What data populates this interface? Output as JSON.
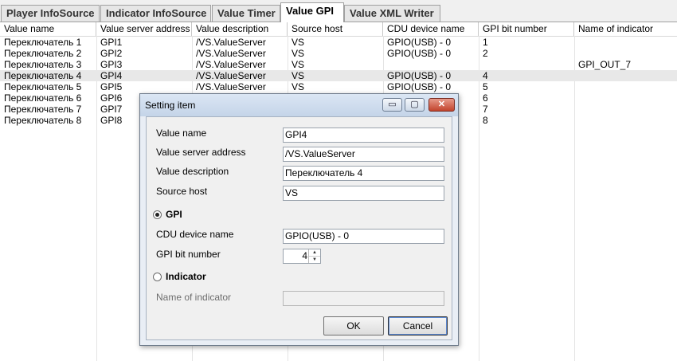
{
  "tabs": [
    {
      "label": "Player InfoSource",
      "active": false
    },
    {
      "label": "Indicator InfoSource",
      "active": false
    },
    {
      "label": "Value Timer",
      "active": false
    },
    {
      "label": "Value GPI",
      "active": true
    },
    {
      "label": "Value XML Writer",
      "active": false
    }
  ],
  "grid": {
    "columns": [
      "Value name",
      "Value server address",
      "Value description",
      "Source host",
      "CDU device name",
      "GPI bit number",
      "Name of indicator"
    ],
    "rows": [
      [
        "Переключатель 1",
        "GPI1",
        "/VS.ValueServer",
        "VS",
        "GPIO(USB) - 0",
        "1",
        ""
      ],
      [
        "Переключатель 2",
        "GPI2",
        "/VS.ValueServer",
        "VS",
        "GPIO(USB) - 0",
        "2",
        ""
      ],
      [
        "Переключатель 3",
        "GPI3",
        "/VS.ValueServer",
        "VS",
        "",
        "",
        "GPI_OUT_7"
      ],
      [
        "Переключатель 4",
        "GPI4",
        "/VS.ValueServer",
        "VS",
        "GPIO(USB) - 0",
        "4",
        ""
      ],
      [
        "Переключатель 5",
        "GPI5",
        "/VS.ValueServer",
        "VS",
        "GPIO(USB) - 0",
        "5",
        ""
      ],
      [
        "Переключатель 6",
        "GPI6",
        "",
        "",
        "",
        "6",
        ""
      ],
      [
        "Переключатель 7",
        "GPI7",
        "",
        "",
        "",
        "7",
        ""
      ],
      [
        "Переключатель 8",
        "GPI8",
        "",
        "",
        "",
        "8",
        ""
      ]
    ],
    "selected_row": 3
  },
  "dialog": {
    "title": "Setting item",
    "window_buttons": {
      "minimize": "▭",
      "maximize": "▢",
      "close": "✕"
    },
    "labels": {
      "value_name": "Value name",
      "server_address": "Value server address",
      "description": "Value description",
      "source_host": "Source host",
      "gpi": "GPI",
      "cdu_device": "CDU device name",
      "gpi_bit": "GPI bit number",
      "indicator": "Indicator",
      "indicator_name": "Name of indicator"
    },
    "values": {
      "value_name": "GPI4",
      "server_address": "/VS.ValueServer",
      "description": "Переключатель 4",
      "source_host": "VS",
      "cdu_device": "GPIO(USB) - 0",
      "gpi_bit": "4",
      "indicator_name": ""
    },
    "mode": "GPI",
    "buttons": {
      "ok": "OK",
      "cancel": "Cancel"
    }
  }
}
